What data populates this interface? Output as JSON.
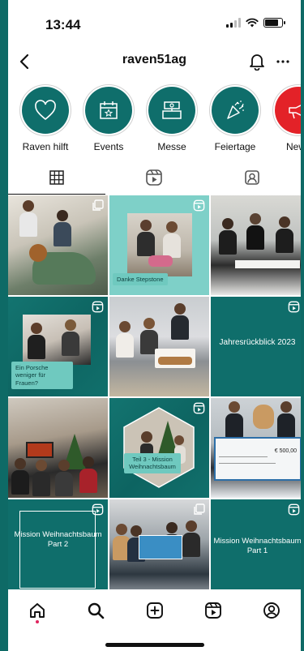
{
  "status": {
    "time": "13:44"
  },
  "header": {
    "username": "raven51ag"
  },
  "highlights": [
    {
      "label": "Raven hilft",
      "icon": "heart-icon"
    },
    {
      "label": "Events",
      "icon": "calendar-star-icon"
    },
    {
      "label": "Messe",
      "icon": "booth-icon"
    },
    {
      "label": "Feiertage",
      "icon": "party-popper-icon"
    },
    {
      "label": "News",
      "icon": "megaphone-icon"
    }
  ],
  "tabs": [
    {
      "name": "grid-tab",
      "icon": "grid-icon"
    },
    {
      "name": "reels-tab",
      "icon": "reels-icon"
    },
    {
      "name": "tagged-tab",
      "icon": "tagged-user-icon"
    }
  ],
  "posts": {
    "p2_caption": "Danke Stepstone",
    "p4_caption": "Ein Porsche weniger für Frauen?",
    "p6_title": "Jahresrückblick 2023",
    "p8_caption": "Teil 3 - Mission Weihnachtsbaum",
    "p9_cheque_amount": "€ 500,00",
    "p10_title": "Mission Weihnachtsbaum Part 2",
    "p12_title": "Mission Weihnachtsbaum Part 1"
  },
  "colors": {
    "brand_teal": "#0f6e6b",
    "accent_red": "#e32228",
    "mint": "#7ed0c8"
  }
}
